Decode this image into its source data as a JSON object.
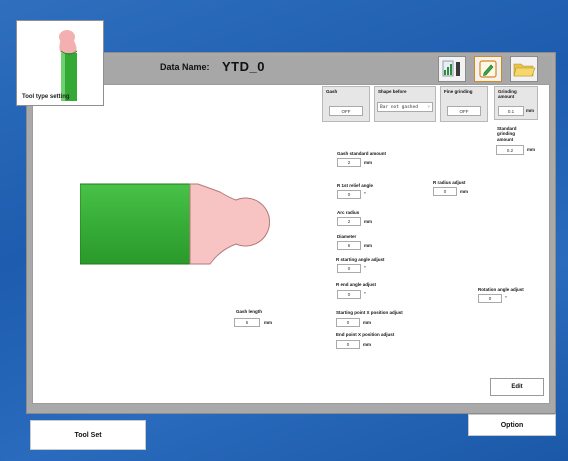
{
  "tool_type": {
    "caption": "Tool type setting"
  },
  "data_name": {
    "label": "Data Name:",
    "value": "YTD_0"
  },
  "header": {
    "gash": {
      "label": "Gash",
      "value": "OFF"
    },
    "shape_before": {
      "label": "Shape before",
      "value": "Bar not gashed"
    },
    "fine_grinding": {
      "label": "Fine grinding",
      "value": "OFF"
    },
    "grinding_amount": {
      "label": "Grinding amount",
      "value": "0.1",
      "unit": "mm"
    },
    "standard_grinding_amount": {
      "label": "Standard grinding amount",
      "value": "0.2",
      "unit": "mm"
    }
  },
  "fields": {
    "gash_standard_amount": {
      "label": "Gash standard amount",
      "value": "2",
      "unit": "mm"
    },
    "r_1st_relief_angle": {
      "label": "R 1st relief angle",
      "value": "0",
      "unit": "°"
    },
    "r_radius_adjust": {
      "label": "R radius adjust",
      "value": "0",
      "unit": "mm"
    },
    "arc_radius": {
      "label": "Arc radius",
      "value": "2",
      "unit": "mm"
    },
    "diameter": {
      "label": "Diameter",
      "value": "6",
      "unit": "mm"
    },
    "r_starting_angle_adjust": {
      "label": "R starting angle adjust",
      "value": "0",
      "unit": "°"
    },
    "r_end_angle_adjust": {
      "label": "R end angle adjust",
      "value": "0",
      "unit": "°"
    },
    "rotation_angle_adjust": {
      "label": "Rotation angle adjust",
      "value": "0",
      "unit": "°"
    },
    "gash_length": {
      "label": "Gash length",
      "value": "5",
      "unit": "mm"
    },
    "starting_point_x_position_adjust": {
      "label": "Starting point X position adjust",
      "value": "0",
      "unit": "mm"
    },
    "end_point_x_position_adjust": {
      "label": "End point X position adjust",
      "value": "0",
      "unit": "mm"
    }
  },
  "buttons": {
    "edit": "Edit",
    "tool_set": "Tool Set",
    "option": "Option"
  },
  "icons": [
    "chart-icon",
    "pencil-icon",
    "folder-icon"
  ],
  "colors": {
    "tool_green": "#3fb33f",
    "tool_pink": "#f7c3c3",
    "background_blue": "#2a68b8"
  }
}
